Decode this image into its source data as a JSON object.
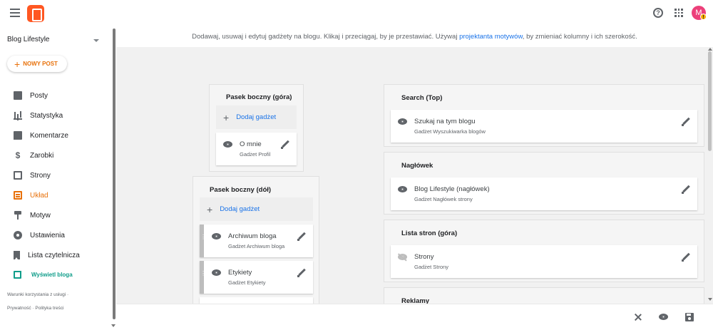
{
  "header": {
    "menu_icon": "hamburger-menu-icon",
    "logo_icon": "blogger-logo-icon",
    "help_icon": "help-circle-icon",
    "apps_icon": "apps-grid-icon",
    "avatar_letter": "M",
    "avatar_badge": "!"
  },
  "sidebar": {
    "blog_name": "Blog Lifestyle",
    "new_post_plus": "+",
    "new_post_label": "NOWY POST",
    "items": [
      {
        "label": "Posty",
        "icon": "posts-icon"
      },
      {
        "label": "Statystyka",
        "icon": "stats-icon"
      },
      {
        "label": "Komentarze",
        "icon": "comments-icon"
      },
      {
        "label": "Zarobki",
        "icon": "earnings-icon"
      },
      {
        "label": "Strony",
        "icon": "pages-icon"
      },
      {
        "label": "Układ",
        "icon": "layout-icon",
        "active": true
      },
      {
        "label": "Motyw",
        "icon": "theme-icon"
      },
      {
        "label": "Ustawienia",
        "icon": "settings-icon"
      },
      {
        "label": "Lista czytelnicza",
        "icon": "reading-list-icon"
      }
    ],
    "view_blog": "Wyświetl bloga",
    "footer": {
      "terms": "Warunki korzystania z usługi",
      "sep": "·",
      "privacy": "Prywatność",
      "content_policy": "Polityka treści"
    }
  },
  "info_bar": {
    "text_before": "Dodawaj, usuwaj i edytuj gadżety na blogu. Klikaj i przeciągaj, by je przestawiać. Używaj ",
    "link": "projektanta motywów",
    "text_after": ", by zmieniać kolumny i ich szerokość."
  },
  "layout": {
    "sidebar_top": {
      "title": "Pasek boczny (góra)",
      "add_gadget": "Dodaj gadżet",
      "gadgets": [
        {
          "name": "O mnie",
          "type": "Gadżet Profil"
        }
      ]
    },
    "sidebar_bottom": {
      "title": "Pasek boczny (dół)",
      "add_gadget": "Dodaj gadżet",
      "gadgets": [
        {
          "name": "Archiwum bloga",
          "type": "Gadżet Archiwum bloga"
        },
        {
          "name": "Etykiety",
          "type": "Gadżet Etykiety"
        }
      ]
    },
    "search_top": {
      "title": "Search (Top)",
      "gadgets": [
        {
          "name": "Szukaj na tym blogu",
          "type": "Gadżet Wyszukiwarka blogów"
        }
      ]
    },
    "header_section": {
      "title": "Nagłówek",
      "gadgets": [
        {
          "name": "Blog Lifestyle (nagłówek)",
          "type": "Gadżet Nagłówek strony"
        }
      ]
    },
    "pages_top": {
      "title": "Lista stron (góra)",
      "gadgets": [
        {
          "name": "Strony",
          "type": "Gadżet Strony",
          "hidden": true
        }
      ]
    },
    "ads": {
      "title": "Reklamy"
    }
  },
  "bottom_bar": {
    "close_icon": "close-icon",
    "preview_icon": "preview-eye-icon",
    "save_icon": "save-icon"
  }
}
